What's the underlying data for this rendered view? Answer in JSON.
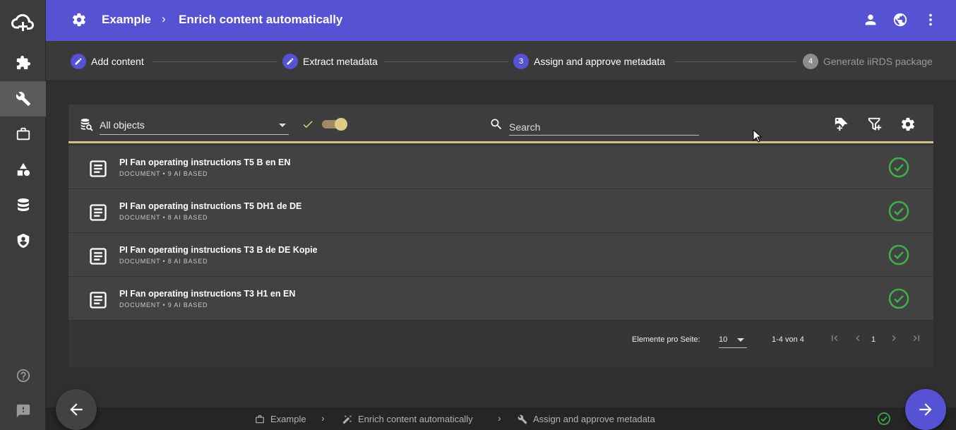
{
  "colors": {
    "accent": "#5652d4",
    "toggle": "#e1c98e",
    "ok": "#3cb04a"
  },
  "header": {
    "project": "Example",
    "separator": "›",
    "title": "Enrich content automatically"
  },
  "stepper": {
    "steps": [
      {
        "label": "Add content",
        "marker": "edit-icon"
      },
      {
        "label": "Extract metadata",
        "marker": "edit-icon"
      },
      {
        "label": "Assign and approve metadata",
        "number": "3"
      },
      {
        "label": "Generate iiRDS package",
        "number": "4"
      }
    ]
  },
  "toolbar": {
    "filter_value": "All objects",
    "search_placeholder": "Search"
  },
  "rows": [
    {
      "title": "PI Fan operating instructions T5 B en EN",
      "sub": "DOCUMENT • 9 AI BASED"
    },
    {
      "title": "PI Fan operating instructions T5 DH1 de DE",
      "sub": "DOCUMENT • 8 AI BASED"
    },
    {
      "title": "PI Fan operating instructions T3 B de DE Kopie",
      "sub": "DOCUMENT • 8 AI BASED"
    },
    {
      "title": "PI Fan operating instructions T3 H1 en EN",
      "sub": "DOCUMENT • 9 AI BASED"
    }
  ],
  "pager": {
    "label": "Elemente pro Seite:",
    "size": "10",
    "range": "1-4 von 4",
    "page": "1"
  },
  "bottom": {
    "crumbs": [
      "Example",
      "Enrich content automatically",
      "Assign and approve metadata"
    ],
    "sep": "›"
  }
}
